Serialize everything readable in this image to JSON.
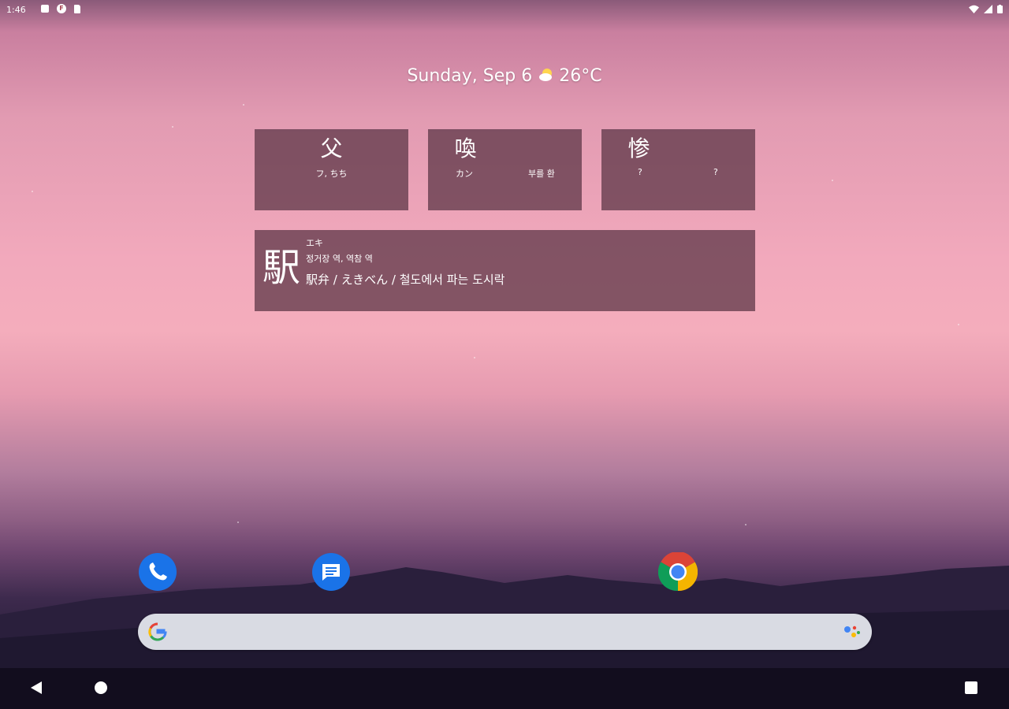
{
  "status_bar": {
    "time": "1:46",
    "notification_icons": [
      "square-icon",
      "f-circle-icon",
      "sd-card-icon"
    ],
    "right_icons": [
      "wifi-icon",
      "signal-icon",
      "battery-icon"
    ]
  },
  "date_widget": {
    "date": "Sunday, Sep 6",
    "weather_icon": "partly-sunny-icon",
    "temperature": "26°C"
  },
  "kanji_tiles": [
    {
      "kanji": "父",
      "reading": "フ, ちち",
      "meaning": ""
    },
    {
      "kanji": "喚",
      "reading": "カン",
      "meaning": "부를 환"
    },
    {
      "kanji": "惨",
      "reading": "?",
      "meaning": "?"
    }
  ],
  "word_tile": {
    "kanji": "駅",
    "reading": "エキ",
    "meaning": "정거장 역, 역참 역",
    "example": "駅弁 / えきべん / 철도에서 파는 도시락"
  },
  "dock_apps": [
    {
      "name": "Phone",
      "icon": "phone-icon",
      "color": "#1a73e8"
    },
    {
      "name": "Messages",
      "icon": "messages-icon",
      "color": "#1a73e8"
    },
    {
      "name": "Chrome",
      "icon": "chrome-icon"
    }
  ],
  "search_bar": {
    "left_icon": "google-g-icon",
    "right_icon": "google-assistant-icon"
  },
  "nav_bar": {
    "buttons": [
      "back",
      "home",
      "recents"
    ]
  }
}
